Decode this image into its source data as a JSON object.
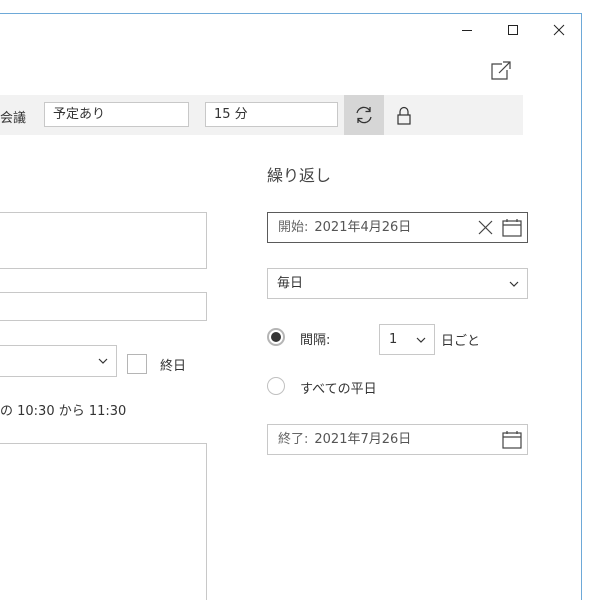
{
  "toolbar": {
    "partial_label": "会議",
    "show_as_value": "予定あり",
    "reminder_value": "15 分"
  },
  "event": {
    "all_day_label": "終日",
    "time_summary": "の 10:30 から 11:30"
  },
  "recurrence": {
    "title": "繰り返し",
    "start_label": "開始:",
    "start_date": "2021年4月26日",
    "frequency_value": "毎日",
    "interval_label": "間隔:",
    "interval_value": "1",
    "interval_unit": "日ごと",
    "weekdays_label": "すべての平日",
    "end_label": "終了:",
    "end_date": "2021年7月26日"
  },
  "colors": {
    "window_border": "#6ea9d8",
    "toolbar_bg": "#f2f2f2",
    "sync_active_bg": "#d6d6d6",
    "field_border": "#c8c8c8",
    "focused_border": "#5a5a5a"
  },
  "icons": {
    "minimize": "minimize-icon",
    "maximize": "maximize-icon",
    "close": "close-icon",
    "popout": "popout-icon",
    "sync": "sync-icon",
    "lock": "lock-icon",
    "clear": "clear-icon",
    "calendar": "calendar-icon",
    "chevron": "chevron-down-icon"
  }
}
